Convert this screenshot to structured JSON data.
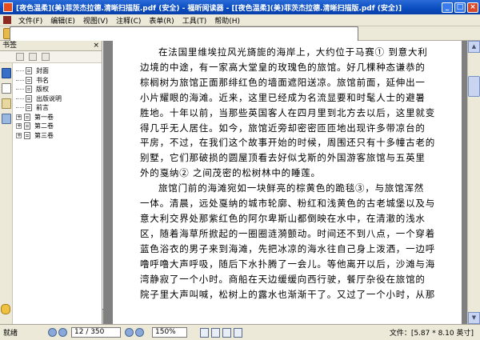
{
  "window": {
    "title": "[夜色温柔](美)菲茨杰拉德.清晰扫描版.pdf (安全) - 福昕阅读器 - [[夜色温柔](美)菲茨杰拉德.清晰扫描版.pdf (安全)]",
    "buttons": {
      "minimize": "_",
      "maximize": "□",
      "close": "×"
    }
  },
  "menu": {
    "items": [
      "文件(F)",
      "编辑(E)",
      "视图(V)",
      "注释(C)",
      "表单(R)",
      "工具(T)",
      "帮助(H)"
    ]
  },
  "sidebar": {
    "title": "书签",
    "close": "×",
    "bookmarks": [
      {
        "label": "封面",
        "expandable": false
      },
      {
        "label": "书名",
        "expandable": false
      },
      {
        "label": "版权",
        "expandable": false
      },
      {
        "label": "出版说明",
        "expandable": false
      },
      {
        "label": "前言",
        "expandable": false
      },
      {
        "label": "第一卷",
        "expandable": true
      },
      {
        "label": "第二卷",
        "expandable": true
      },
      {
        "label": "第三卷",
        "expandable": true
      }
    ]
  },
  "document": {
    "lines": [
      {
        "text": "在法国里维埃拉风光旖旎的海岸上，大约位于马赛① 到意大利",
        "indent": true
      },
      {
        "text": "边境的中途，有一家高大堂皇的玫瑰色的旅馆。好几棵种态谦恭的",
        "indent": false
      },
      {
        "text": "棕榈树为旅馆正面那绯红色的墙面遮阳送凉。旅馆前面，延伸出一",
        "indent": false
      },
      {
        "text": "小片耀眼的海滩。近来，这里已经成为名流显要和时髦人士的避暑",
        "indent": false
      },
      {
        "text": "胜地。十年以前，当那些英国客人在四月里到北方去以后，这里就变",
        "indent": false
      },
      {
        "text": "得几乎无人居住。如今，旅馆近旁却密密匝匝地出现许多带凉台的",
        "indent": false
      },
      {
        "text": "平房，不过，在我们这个故事开始的时候，周围还只有十多幢古老的",
        "indent": false
      },
      {
        "text": "别墅，它们那破损的圆屋顶看去好似戈斯的外国游客旅馆与五英里",
        "indent": false
      },
      {
        "text": "外的戛纳② 之间茂密的松树林中的睡莲。",
        "indent": false
      },
      {
        "text": "旅馆门前的海滩宛如一块鲜亮的棕黄色的跪毯③，与旅馆浑然",
        "indent": true
      },
      {
        "text": "一体。清晨，远处戛纳的城市轮廓、粉红和浅黄色的古老城堡以及与",
        "indent": false
      },
      {
        "text": "意大利交界处那紫红色的阿尔卑斯山都倒映在水中，在清澈的浅水",
        "indent": false
      },
      {
        "text": "区，随着海草所掀起的一圈圈涟漪颤动。时间还不到八点，一个穿着",
        "indent": false
      },
      {
        "text": "蓝色浴衣的男子来到海滩，先把冰凉的海水往自己身上泼洒，一边呼",
        "indent": false
      },
      {
        "text": "噜呼噜大声呼吸，随后下水扑腾了一会儿。等他离开以后，沙滩与海",
        "indent": false
      },
      {
        "text": "湾静寂了一个小时。商船在天边缓缓向西行驶，餐厅杂役在旅馆的",
        "indent": false
      },
      {
        "text": "院子里大声叫喊，松树上的露水也渐渐干了。又过了一个小时，从那",
        "indent": false
      }
    ]
  },
  "statusbar": {
    "ready": "就绪",
    "page": "12 / 350",
    "zoom": "150%",
    "file_info": "文件：[5.87 * 8.10 英寸]"
  },
  "colors": {
    "titlebar": "#0a4cc0",
    "chrome": "#ece9d8",
    "workspace": "#808080"
  }
}
